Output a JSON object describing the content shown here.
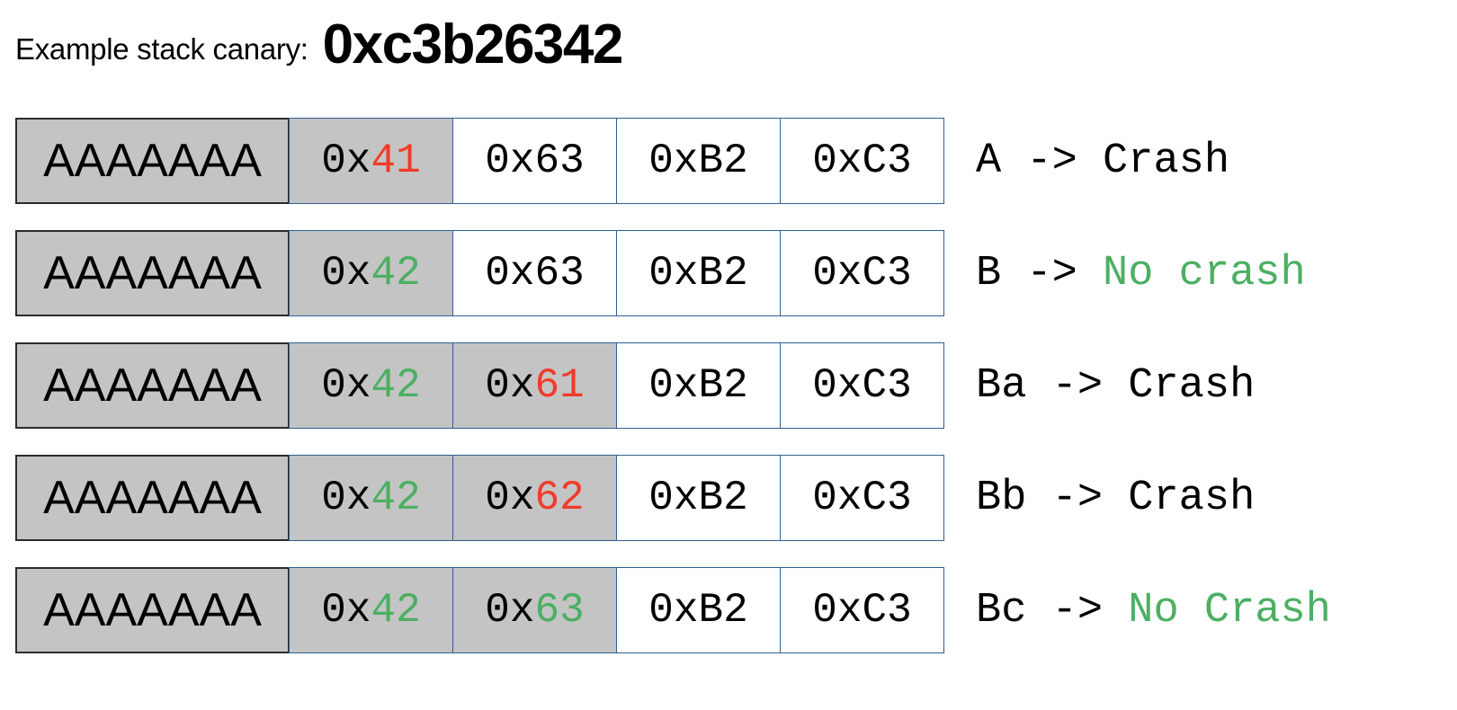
{
  "title": {
    "label": "Example stack canary:",
    "canary": "0xc3b26342"
  },
  "colors": {
    "red": "#ef3b29",
    "green": "#4caf62",
    "cell_border": "#2f5f93",
    "buffer_border": "#2b2b2b",
    "shaded_fill": "#c4c4c4",
    "text": "#000000"
  },
  "rows": [
    {
      "buffer": "AAAAAAA",
      "buffer_shaded": true,
      "bytes": [
        {
          "prefix": "0x",
          "value": "41",
          "value_color": "red",
          "shaded": true
        },
        {
          "prefix": "0x",
          "value": "63",
          "value_color": "black",
          "shaded": false
        },
        {
          "prefix": "0x",
          "value": "B2",
          "value_color": "black",
          "shaded": false
        },
        {
          "prefix": "0x",
          "value": "C3",
          "value_color": "black",
          "shaded": false
        }
      ],
      "annotation": {
        "input": "A",
        "arrow": " -> ",
        "result": "Crash",
        "result_color": "black"
      }
    },
    {
      "buffer": "AAAAAAA",
      "buffer_shaded": true,
      "bytes": [
        {
          "prefix": "0x",
          "value": "42",
          "value_color": "green",
          "shaded": true
        },
        {
          "prefix": "0x",
          "value": "63",
          "value_color": "black",
          "shaded": false
        },
        {
          "prefix": "0x",
          "value": "B2",
          "value_color": "black",
          "shaded": false
        },
        {
          "prefix": "0x",
          "value": "C3",
          "value_color": "black",
          "shaded": false
        }
      ],
      "annotation": {
        "input": "B",
        "arrow": " -> ",
        "result": "No crash",
        "result_color": "green"
      }
    },
    {
      "buffer": "AAAAAAA",
      "buffer_shaded": true,
      "bytes": [
        {
          "prefix": "0x",
          "value": "42",
          "value_color": "green",
          "shaded": true
        },
        {
          "prefix": "0x",
          "value": "61",
          "value_color": "red",
          "shaded": true
        },
        {
          "prefix": "0x",
          "value": "B2",
          "value_color": "black",
          "shaded": false
        },
        {
          "prefix": "0x",
          "value": "C3",
          "value_color": "black",
          "shaded": false
        }
      ],
      "annotation": {
        "input": "Ba",
        "arrow": " -> ",
        "result": "Crash",
        "result_color": "black"
      }
    },
    {
      "buffer": "AAAAAAA",
      "buffer_shaded": true,
      "bytes": [
        {
          "prefix": "0x",
          "value": "42",
          "value_color": "green",
          "shaded": true
        },
        {
          "prefix": "0x",
          "value": "62",
          "value_color": "red",
          "shaded": true
        },
        {
          "prefix": "0x",
          "value": "B2",
          "value_color": "black",
          "shaded": false
        },
        {
          "prefix": "0x",
          "value": "C3",
          "value_color": "black",
          "shaded": false
        }
      ],
      "annotation": {
        "input": "Bb",
        "arrow": " -> ",
        "result": "Crash",
        "result_color": "black"
      }
    },
    {
      "buffer": "AAAAAAA",
      "buffer_shaded": true,
      "bytes": [
        {
          "prefix": "0x",
          "value": "42",
          "value_color": "green",
          "shaded": true
        },
        {
          "prefix": "0x",
          "value": "63",
          "value_color": "green",
          "shaded": true
        },
        {
          "prefix": "0x",
          "value": "B2",
          "value_color": "black",
          "shaded": false
        },
        {
          "prefix": "0x",
          "value": "C3",
          "value_color": "black",
          "shaded": false
        }
      ],
      "annotation": {
        "input": "Bc",
        "arrow": " -> ",
        "result": "No Crash",
        "result_color": "green"
      }
    }
  ]
}
